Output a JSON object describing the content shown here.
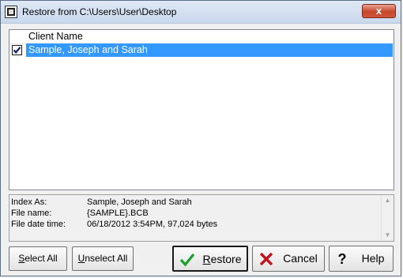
{
  "window": {
    "title": "Restore from C:\\Users\\User\\Desktop",
    "close_label": "x"
  },
  "list": {
    "column_header": "Client Name",
    "rows": [
      {
        "label": "Sample, Joseph and Sarah",
        "checked": true,
        "selected": true
      }
    ]
  },
  "info": {
    "index_as_label": "Index As:",
    "index_as_value": "Sample, Joseph and Sarah",
    "file_name_label": "File name:",
    "file_name_value": "{SAMPLE}.BCB",
    "file_date_label": "File date time:",
    "file_date_value": "06/18/2012  3:54PM,  97,024 bytes"
  },
  "buttons": {
    "select_all": {
      "pre": "",
      "u": "S",
      "post": "elect All"
    },
    "unselect_all": {
      "pre": "",
      "u": "U",
      "post": "nselect All"
    },
    "restore": {
      "pre": "",
      "u": "R",
      "post": "estore"
    },
    "cancel": "Cancel",
    "help": "Help"
  },
  "colors": {
    "selection": "#3399ff",
    "restore_check": "#1e9e2a",
    "cancel_x": "#c0141e"
  }
}
